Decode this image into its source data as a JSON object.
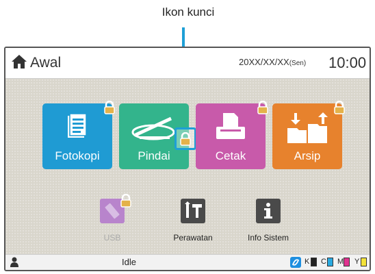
{
  "callout": {
    "label": "Ikon kunci"
  },
  "header": {
    "home_label": "Awal",
    "date": "20XX/XX/XX",
    "day": "(Sen)",
    "time": "10:00"
  },
  "tiles": [
    {
      "label": "Fotokopi",
      "color": "#1f9bd3",
      "locked": true
    },
    {
      "label": "Pindai",
      "color": "#33b48c",
      "locked": true
    },
    {
      "label": "Cetak",
      "color": "#c85aaa",
      "locked": true
    },
    {
      "label": "Arsip",
      "color": "#e7822d",
      "locked": true
    }
  ],
  "small_buttons": [
    {
      "label": "USB",
      "disabled": true,
      "locked": true
    },
    {
      "label": "Perawatan",
      "disabled": false
    },
    {
      "label": "Info Sistem",
      "disabled": false
    }
  ],
  "status": {
    "text": "Idle",
    "inks": [
      "K",
      "C",
      "M",
      "Y"
    ],
    "ink_colors": [
      "#222222",
      "#29a9e0",
      "#e0338f",
      "#f3e23a"
    ]
  }
}
